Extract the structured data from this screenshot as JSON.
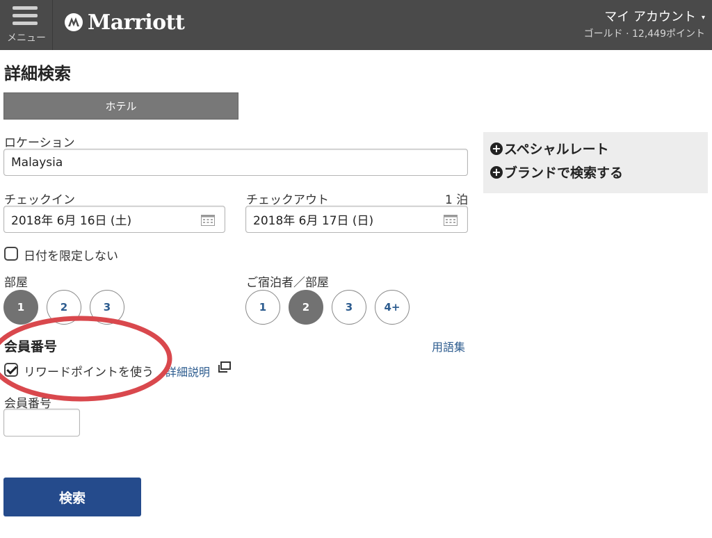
{
  "header": {
    "menu_label": "メニュー",
    "logo_text": "Marriott",
    "account_name": "マイ アカウント",
    "account_caret": "▾",
    "account_points": "ゴールド · 12,449ポイント",
    "background_color": "#4a4a4a"
  },
  "page_title": "詳細検索",
  "tabs": {
    "hotel": "ホテル"
  },
  "location": {
    "label": "ロケーション",
    "value": "Malaysia"
  },
  "checkin": {
    "label": "チェックイン",
    "value": "2018年 6月 16日 (土)"
  },
  "checkout": {
    "label": "チェックアウト",
    "nights": "1 泊",
    "value": "2018年 6月 17日 (日)"
  },
  "flexible_dates": {
    "label": "日付を限定しない",
    "checked": false
  },
  "rooms": {
    "label": "部屋",
    "options": [
      "1",
      "2",
      "3"
    ],
    "selected": "1"
  },
  "guests": {
    "label": "ご宿泊者／部屋",
    "options": [
      "1",
      "2",
      "3",
      "4+"
    ],
    "selected": "2"
  },
  "membership": {
    "title": "会員番号",
    "glossary_link": "用語集",
    "use_points_label": "リワードポイントを使う",
    "use_points_checked": true,
    "details_link": "詳細説明",
    "member_number_label": "会員番号",
    "member_number_value": ""
  },
  "search_button": "検索",
  "side_panel": {
    "special_rate": "スペシャルレート",
    "brand_search": "ブランドで検索する"
  },
  "colors": {
    "accent": "#254b8c",
    "link": "#2d5c8f",
    "annotation": "#d9484d"
  }
}
